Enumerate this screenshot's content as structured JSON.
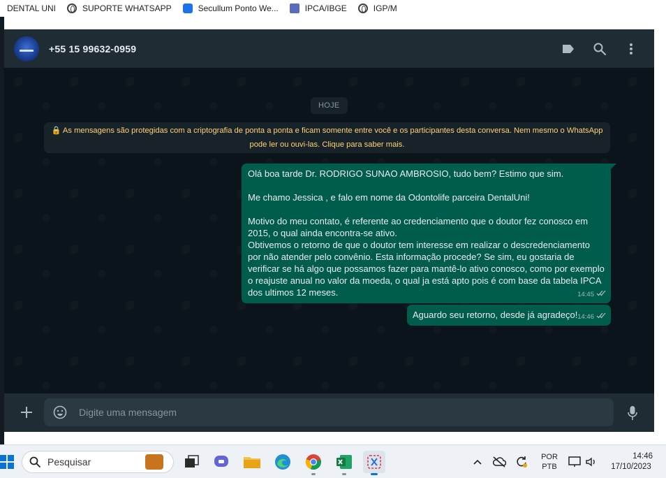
{
  "bookmarks": [
    {
      "label": "DENTAL UNI",
      "icon": "none"
    },
    {
      "label": "SUPORTE WHATSAPP",
      "icon": "globe-icon"
    },
    {
      "label": "Secullum Ponto We...",
      "icon": "secullum-icon"
    },
    {
      "label": "IPCA/IBGE",
      "icon": "ibge-icon"
    },
    {
      "label": "IGP/M",
      "icon": "globe-icon"
    }
  ],
  "header": {
    "contact_name": "+55 15 99632-0959",
    "icons": [
      "label-icon",
      "search-icon",
      "menu-dots-icon"
    ]
  },
  "chat": {
    "date_chip": "HOJE",
    "encryption_notice_line1": "🔒 As mensagens são protegidas com a criptografia de ponta a ponta e ficam somente entre você e os participantes desta conversa. Nem mesmo o WhatsApp",
    "encryption_notice_line2": "pode ler ou ouvi-las. Clique para saber mais.",
    "messages": [
      {
        "text": "Olá boa tarde Dr. RODRIGO SUNAO AMBROSIO, tudo bem? Estimo que sim.\n\nMe chamo Jessica , e falo em nome da Odontolife parceira DentalUni!\n\nMotivo do meu contato, é referente ao credenciamento que o doutor fez conosco em 2015, o qual ainda encontra-se ativo.\nObtivemos o retorno de que o doutor tem interesse em realizar o descredenciamento por não atender pelo convênio. Esta informação procede? Se sim, eu gostaria de verificar se há algo que possamos fazer para mantê-lo ativo conosco, como por exemplo o reajuste anual no valor da moeda, o qual ja está apto pois é com base da tabela IPCA dos ultimos 12 meses.",
        "time": "14:45",
        "status": "read"
      },
      {
        "text": "Aguardo seu retorno, desde já agradeço!",
        "time": "14:46",
        "status": "read"
      }
    ]
  },
  "composer": {
    "placeholder": "Digite uma mensagem"
  },
  "taskbar": {
    "search_label": "Pesquisar",
    "language_line1": "POR",
    "language_line2": "PTB",
    "clock_time": "14:46",
    "clock_date": "17/10/2023"
  },
  "colors": {
    "header_bg": "#202c33",
    "chat_bg": "#0b141a",
    "outgoing_bubble": "#005c4b",
    "notice_text": "#ffd279",
    "icon_gray": "#aebac1",
    "read_ticks": "#99beb7"
  }
}
